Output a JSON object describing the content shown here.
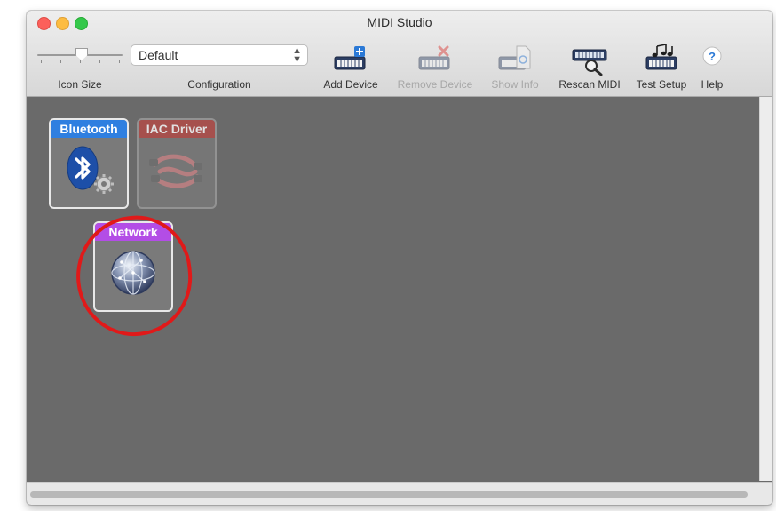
{
  "window": {
    "title": "MIDI Studio"
  },
  "toolbar": {
    "icon_size": {
      "label": "Icon Size",
      "value": 0.5
    },
    "configuration": {
      "label": "Configuration",
      "selected": "Default"
    },
    "buttons": [
      {
        "label": "Add Device",
        "enabled": true,
        "icon": "add-device-icon"
      },
      {
        "label": "Remove Device",
        "enabled": false,
        "icon": "remove-device-icon"
      },
      {
        "label": "Show Info",
        "enabled": false,
        "icon": "show-info-icon"
      },
      {
        "label": "Rescan MIDI",
        "enabled": true,
        "icon": "rescan-midi-icon"
      },
      {
        "label": "Test Setup",
        "enabled": true,
        "icon": "test-setup-icon"
      },
      {
        "label": "Help",
        "enabled": true,
        "icon": "help-icon",
        "glyph": "?"
      }
    ]
  },
  "devices": [
    {
      "name": "Bluetooth",
      "color": "#2f7fe0",
      "online": true,
      "icon": "bluetooth-icon"
    },
    {
      "name": "IAC Driver",
      "color": "#b54a46",
      "online": false,
      "icon": "iac-driver-icon"
    },
    {
      "name": "Network",
      "color": "#b34de6",
      "online": true,
      "icon": "network-globe-icon",
      "highlighted": true
    }
  ],
  "annotation": {
    "color": "#e01919"
  }
}
